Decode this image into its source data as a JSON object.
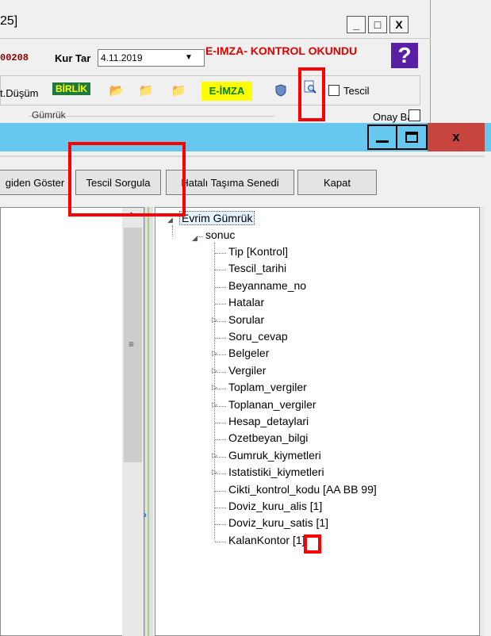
{
  "background_window": {
    "title_fragment": "25]",
    "sys_minimize": "_",
    "sys_maximize": "□",
    "sys_close": "X",
    "code_fragment": "00208",
    "kur_tar_label": "Kur Tar",
    "kur_tar_value": "4.11.2019",
    "dropdown_arrow": "▼",
    "eimza_message": "E-IMZA- KONTROL OKUNDU",
    "help_button": "?",
    "dusum_label": "t.Düşüm",
    "birlik_label": "BİRLİK",
    "eimza_button": "E-İMZA",
    "tescil_label": "Tescil",
    "gumruk_label": "Gümrük",
    "onay_bas_label": "Onay Bas."
  },
  "dialog": {
    "minimize": "_",
    "maximize": "□",
    "close": "x",
    "buttons": {
      "geriden_goster": "giden Göster",
      "tescil_sorgula": "Tescil Sorgula",
      "hatali_tasima": "Hatalı Taşıma Senedi",
      "kapat": "Kapat"
    },
    "tree": {
      "root": "Evrim Gümrük",
      "sonuc": "sonuc",
      "children": [
        "Tip [Kontrol]",
        "Tescil_tarihi",
        "Beyanname_no",
        "Hatalar",
        "Sorular",
        "Soru_cevap",
        "Belgeler",
        "Vergiler",
        "Toplam_vergiler",
        "Toplanan_vergiler",
        "Hesap_detaylari",
        "Ozetbeyan_bilgi",
        "Gumruk_kiymetleri",
        "Istatistiki_kiymetleri",
        "Cikti_kontrol_kodu [AA BB 99]",
        "Doviz_kuru_alis [1]",
        "Doviz_kuru_satis [1]",
        "KalanKontor [1]"
      ],
      "expandable": [
        false,
        false,
        false,
        false,
        true,
        false,
        true,
        true,
        true,
        true,
        false,
        false,
        true,
        true,
        false,
        false,
        false,
        false
      ]
    }
  },
  "colors": {
    "dialog_titlebar": "#66c8ee",
    "close_button": "#c8453f",
    "highlight_box": "#ff0000",
    "eimza_message": "#e00000",
    "birlik_bg": "#1c7b3c",
    "eimza_bg": "#ffff00"
  }
}
